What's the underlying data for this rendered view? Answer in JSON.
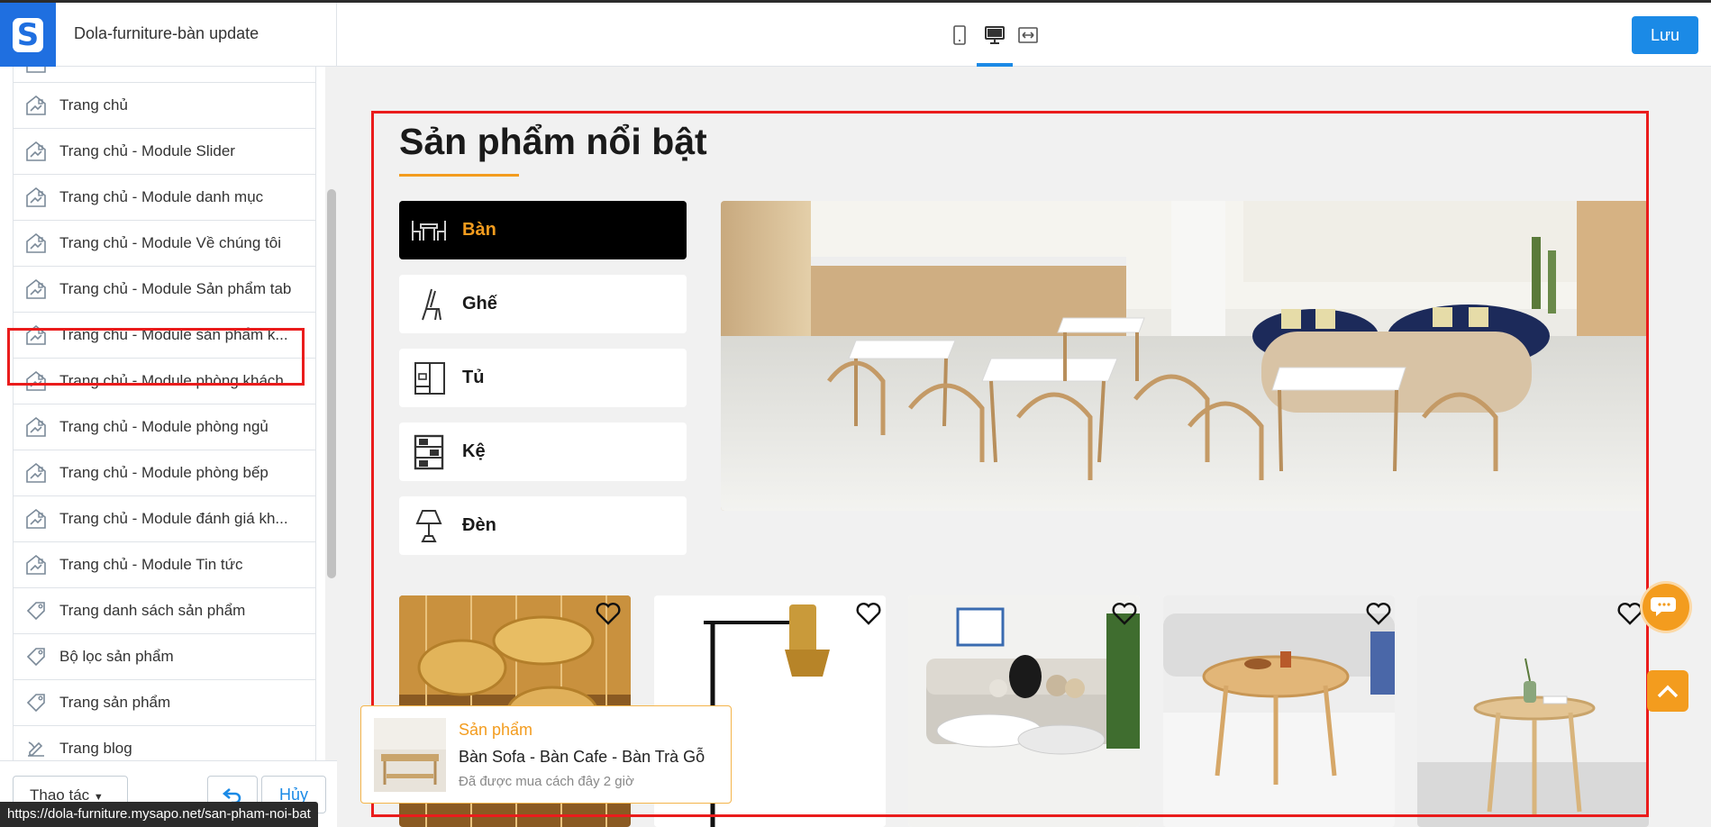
{
  "app": {
    "theme_title": "Dola-furniture-bàn update",
    "save_label": "Lưu",
    "devices": [
      "mobile-icon",
      "desktop-icon",
      "fullwidth-icon"
    ],
    "accent": "#1b8ae6"
  },
  "sidebar": {
    "partial_item": "",
    "items": [
      {
        "label": "Trang chủ",
        "icon": "layout-icon"
      },
      {
        "label": "Trang chủ - Module Slider",
        "icon": "layout-icon"
      },
      {
        "label": "Trang chủ - Module danh mục",
        "icon": "layout-icon"
      },
      {
        "label": "Trang chủ - Module Về chúng tôi",
        "icon": "layout-icon"
      },
      {
        "label": "Trang chủ - Module Sản phẩm tab",
        "icon": "layout-icon"
      },
      {
        "label": "Trang chủ - Module sản phẩm k...",
        "icon": "layout-icon"
      },
      {
        "label": "Trang chủ - Module phòng khách",
        "icon": "layout-icon"
      },
      {
        "label": "Trang chủ - Module phòng ngủ",
        "icon": "layout-icon"
      },
      {
        "label": "Trang chủ - Module phòng bếp",
        "icon": "layout-icon"
      },
      {
        "label": "Trang chủ - Module đánh giá kh...",
        "icon": "layout-icon"
      },
      {
        "label": "Trang chủ - Module Tin tức",
        "icon": "layout-icon"
      },
      {
        "label": "Trang danh sách sản phẩm",
        "icon": "tag-icon"
      },
      {
        "label": "Bộ lọc sản phẩm",
        "icon": "tag-icon"
      },
      {
        "label": "Trang sản phẩm",
        "icon": "tag-icon"
      },
      {
        "label": "Trang blog",
        "icon": "blog-icon"
      }
    ],
    "actions_label": "Thao tác",
    "cancel_label": "Hủy"
  },
  "status_url": "https://dola-furniture.mysapo.net/san-pham-noi-bat",
  "preview": {
    "section_title": "Sản phẩm nổi bật",
    "accent": "#f39c1e",
    "tabs": [
      {
        "label": "Bàn",
        "icon": "table-chairs-icon",
        "active": true
      },
      {
        "label": "Ghế",
        "icon": "chair-icon",
        "active": false
      },
      {
        "label": "Tủ",
        "icon": "wardrobe-icon",
        "active": false
      },
      {
        "label": "Kệ",
        "icon": "shelf-icon",
        "active": false
      },
      {
        "label": "Đèn",
        "icon": "lamp-icon",
        "active": false
      }
    ],
    "notification": {
      "category": "Sản phẩm",
      "product": "Bàn Sofa - Bàn Cafe - Bàn Trà Gỗ",
      "time": "Đã được mua cách đây 2 giờ"
    }
  }
}
